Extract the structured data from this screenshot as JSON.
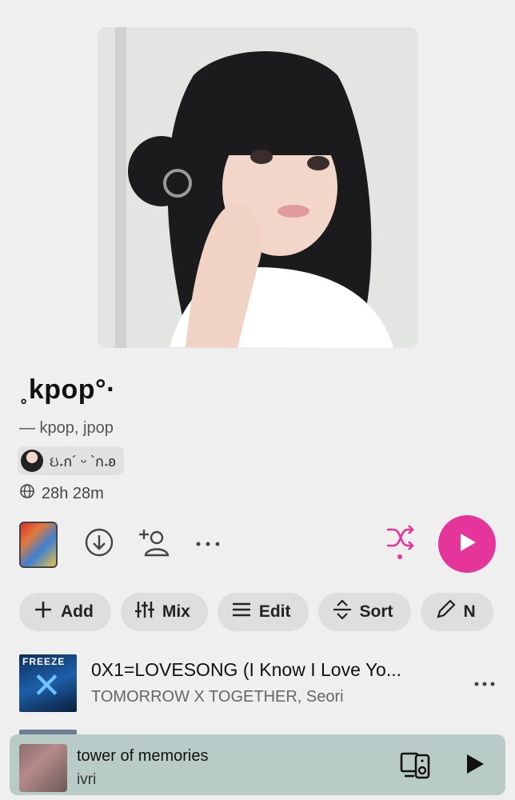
{
  "playlist": {
    "title": "˳kpop°·",
    "description": "— kpop, jpop",
    "owner_name": "ઇ𝅄ก´ ᵕ `ก𝅄ʚ",
    "duration": "28h 28m"
  },
  "action_chips": [
    {
      "label": "Add",
      "icon": "plus-icon"
    },
    {
      "label": "Mix",
      "icon": "sliders-icon"
    },
    {
      "label": "Edit",
      "icon": "lines-icon"
    },
    {
      "label": "Sort",
      "icon": "sort-icon"
    },
    {
      "label": "N",
      "icon": "pencil-icon"
    }
  ],
  "tracks": [
    {
      "title": "0X1=LOVESONG (I Know I Love Yo...",
      "artist": "TOMORROW X TOGETHER, Seori",
      "art_label": "FREEZE"
    }
  ],
  "now_playing": {
    "title": "tower of memories",
    "artist": "ivri"
  },
  "colors": {
    "accent": "#e5359a",
    "background": "#efefef",
    "player_bg": "#b9cbc6",
    "chip_bg": "#dedede"
  }
}
